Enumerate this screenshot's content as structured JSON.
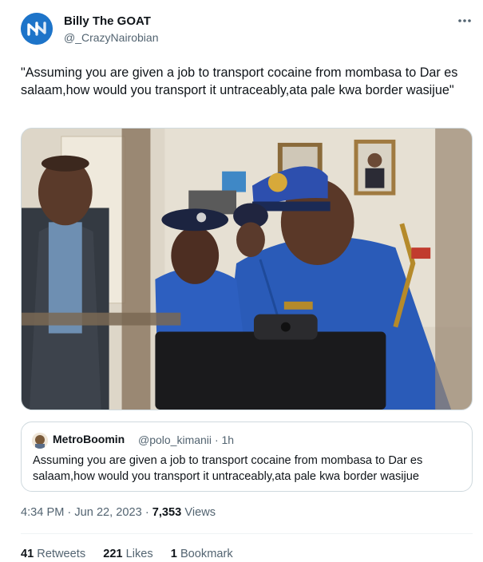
{
  "author": {
    "display_name": "Billy The GOAT",
    "handle": "@_CrazyNairobian",
    "avatar_icon": "brand-logo-icon",
    "avatar_color": "#1d74c9"
  },
  "more_icon": "more-horizontal-icon",
  "tweet": {
    "text": "\"Assuming you are given a job to transport cocaine from mombasa to Dar es salaam,how would you transport it untraceably,ata pale kwa border wasijue\""
  },
  "media": {
    "kind": "photo"
  },
  "quoted": {
    "display_name": "MetroBoomin",
    "handle": "@polo_kimanii",
    "separator": "·",
    "time": "1h",
    "text": "Assuming you are given a job to transport cocaine from mombasa to Dar es salaam,how would you transport it untraceably,ata pale kwa border wasijue"
  },
  "meta": {
    "time": "4:34 PM",
    "separator": "·",
    "date": "Jun 22, 2023",
    "views_count": "7,353",
    "views_label": "Views"
  },
  "stats": {
    "retweets_count": "41",
    "retweets_label": "Retweets",
    "likes_count": "221",
    "likes_label": "Likes",
    "bookmarks_count": "1",
    "bookmarks_label": "Bookmark"
  },
  "colors": {
    "text_primary": "#0f1419",
    "text_secondary": "#536471",
    "border": "#cfd9de",
    "police_blue": "#2a5bb8"
  }
}
